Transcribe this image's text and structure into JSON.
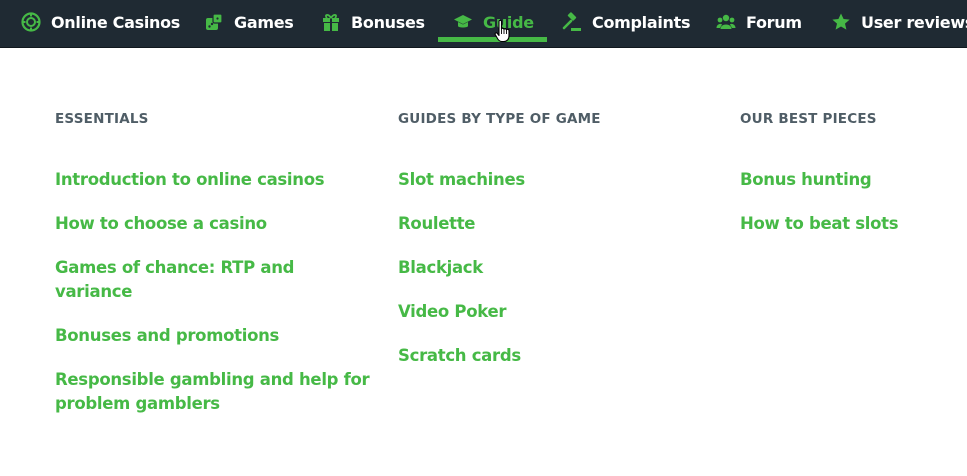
{
  "nav": {
    "items": [
      {
        "label": "Online Casinos",
        "icon": "casino-chip-icon"
      },
      {
        "label": "Games",
        "icon": "dice-icon"
      },
      {
        "label": "Bonuses",
        "icon": "gift-icon"
      },
      {
        "label": "Guide",
        "icon": "graduation-cap-icon",
        "active": true
      },
      {
        "label": "Complaints",
        "icon": "gavel-icon"
      },
      {
        "label": "Forum",
        "icon": "users-icon"
      },
      {
        "label": "User reviews",
        "icon": "star-icon"
      }
    ]
  },
  "menu": {
    "columns": [
      {
        "heading": "ESSENTIALS",
        "links": [
          "Introduction to online casinos",
          "How to choose a casino",
          "Games of chance: RTP and variance",
          "Bonuses and promotions",
          "Responsible gambling and help for problem gamblers"
        ]
      },
      {
        "heading": "GUIDES BY TYPE OF GAME",
        "links": [
          "Slot machines",
          "Roulette",
          "Blackjack",
          "Video Poker",
          "Scratch cards"
        ]
      },
      {
        "heading": "OUR BEST PIECES",
        "links": [
          "Bonus hunting",
          "How to beat slots"
        ]
      }
    ]
  },
  "colors": {
    "nav_bg": "#1f2a33",
    "accent": "#46b946",
    "heading": "#4f5d66"
  }
}
